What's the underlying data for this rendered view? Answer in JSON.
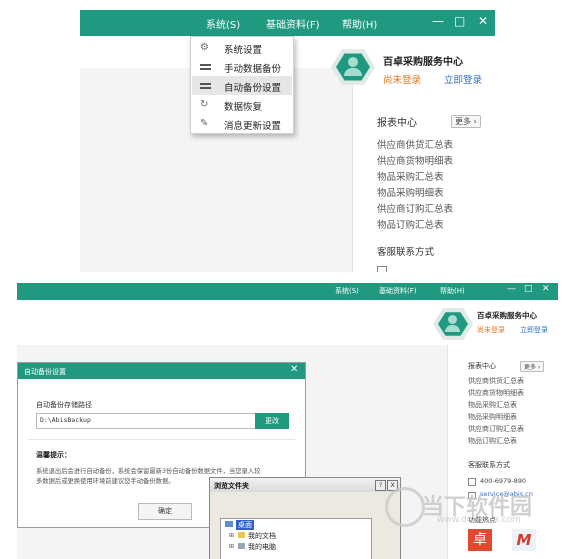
{
  "colors": {
    "brand": "#1f9a80",
    "orange_link": "#e8731d",
    "blue_link": "#2f6fbf"
  },
  "app1": {
    "menu": [
      "系统(S)",
      "基础资料(F)",
      "帮助(H)"
    ],
    "window_buttons": [
      "—",
      "□",
      "✕"
    ],
    "dropdown": [
      {
        "label": "系统设置",
        "icon": "gear-icon"
      },
      {
        "label": "手动数据备份",
        "icon": "list-icon"
      },
      {
        "label": "自动备份设置",
        "icon": "list-icon"
      },
      {
        "label": "数据恢复",
        "icon": "restore-icon"
      },
      {
        "label": "消息更新设置",
        "icon": "edit-icon"
      }
    ],
    "center_title": "百卓采购服务中心",
    "not_logged_in": "尚未登录",
    "login_now": "立即登录",
    "reports_title": "报表中心",
    "more": "更多",
    "reports": [
      "供应商供货汇总表",
      "供应商货物明细表",
      "物品采购汇总表",
      "物品采购明细表",
      "供应商订购汇总表",
      "物品订购汇总表"
    ],
    "contact_title": "客服联系方式"
  },
  "app2": {
    "menu": [
      "系统(S)",
      "基础资料(F)",
      "帮助(H)"
    ],
    "window_buttons": [
      "—",
      "□",
      "✕"
    ],
    "center_title": "百卓采购服务中心",
    "not_logged_in": "尚未登录",
    "login_now": "立即登录",
    "reports_title": "报表中心",
    "more": "更多",
    "reports": [
      "供应商供货汇总表",
      "供应商货物明细表",
      "物品采购汇总表",
      "物品采购明细表",
      "供应商订购汇总表",
      "物品订购汇总表"
    ],
    "contact_title": "客服联系方式",
    "phone": "400-6979-890",
    "email": "service@abis.cn",
    "features": "功能热点",
    "dialog": {
      "title": "自动备份设置",
      "path_label": "自动备份存储路径",
      "path_value": "D:\\AbisBackup",
      "change": "更改",
      "tip_title": "温馨提示：",
      "tip_text_1": "系统退出后会进行自动备份，系统会保留最新3份自动备份数据文件，当您录入较",
      "tip_text_2": "多数据后或更换使用环境前建议您手动备份数据。",
      "ok": "确定"
    },
    "browse": {
      "title": "浏览文件夹",
      "help": "?",
      "close": "X",
      "tree": [
        "桌面",
        "我的文档",
        "我的电脑"
      ]
    }
  },
  "watermark": {
    "site_cn": "当下软件园",
    "site_url": "www.downxia.com"
  }
}
